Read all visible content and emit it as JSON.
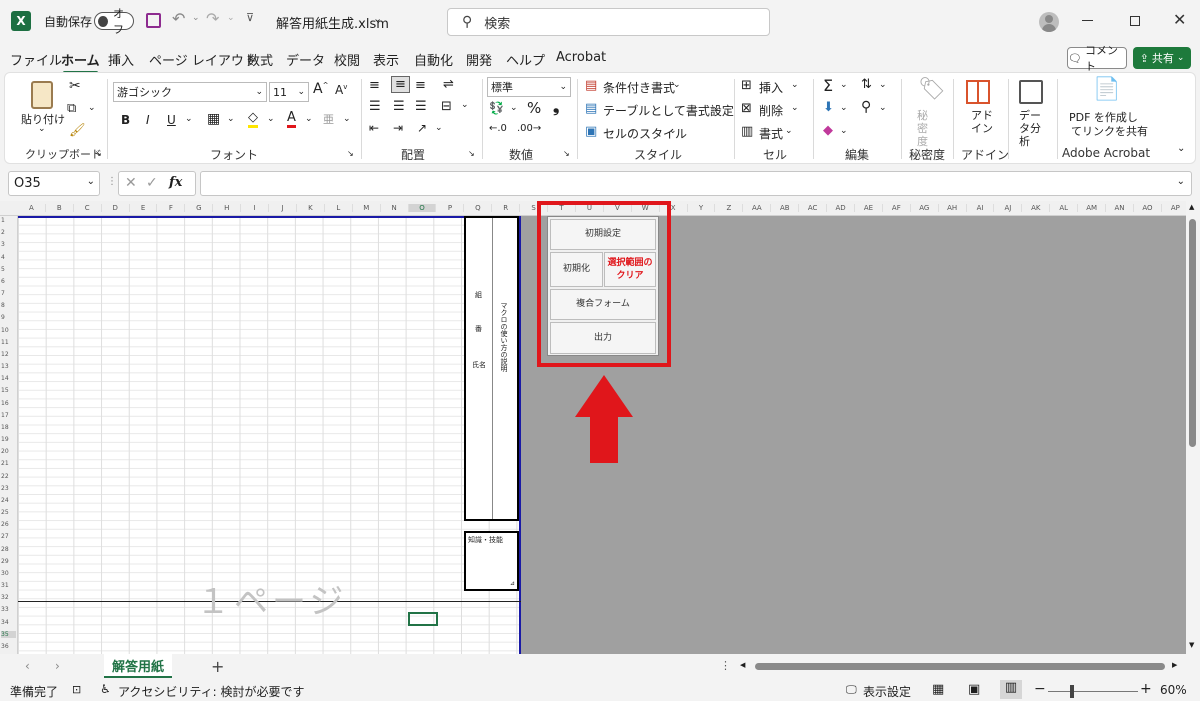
{
  "titlebar": {
    "autosave_label": "自動保存",
    "autosave_state": "オフ",
    "filename": "解答用紙生成.xlsm",
    "search_placeholder": "検索"
  },
  "menu": {
    "items": [
      "ファイル",
      "ホーム",
      "挿入",
      "ページ レイアウト",
      "数式",
      "データ",
      "校閲",
      "表示",
      "自動化",
      "開発",
      "ヘルプ",
      "Acrobat"
    ],
    "active": "ホーム",
    "comment_label": "コメント",
    "share_label": "共有"
  },
  "ribbon": {
    "clipboard": {
      "paste": "貼り付け",
      "label": "クリップボード"
    },
    "font": {
      "name": "游ゴシック",
      "size": "11",
      "label": "フォント"
    },
    "alignment": {
      "label": "配置"
    },
    "number": {
      "format": "標準",
      "label": "数値"
    },
    "styles": {
      "conditional": "条件付き書式",
      "table": "テーブルとして書式設定",
      "cell_style": "セルのスタイル",
      "label": "スタイル"
    },
    "cells": {
      "insert": "挿入",
      "delete": "削除",
      "format": "書式",
      "label": "セル"
    },
    "editing": {
      "label": "編集"
    },
    "sensitivity": {
      "button": "秘密度",
      "label": "秘密度"
    },
    "addins": {
      "button": "アドイン",
      "label": "アドイン"
    },
    "analysis": {
      "button": "データ分析"
    },
    "acrobat": {
      "button_line1": "PDF を作成し",
      "button_line2": "てリンクを共有",
      "label": "Adobe Acrobat"
    }
  },
  "formula": {
    "namebox": "O35",
    "fx": "fx",
    "value": ""
  },
  "sheet": {
    "columns": [
      "A",
      "B",
      "C",
      "D",
      "E",
      "F",
      "G",
      "H",
      "I",
      "J",
      "K",
      "L",
      "M",
      "N",
      "O",
      "P",
      "Q",
      "R",
      "S",
      "T",
      "U",
      "V",
      "W",
      "X",
      "Y",
      "Z",
      "AA",
      "AB",
      "AC",
      "AD",
      "AE",
      "AF",
      "AG",
      "AH",
      "AI",
      "AJ",
      "AK",
      "AL",
      "AM",
      "AN",
      "AO",
      "AP"
    ],
    "rows": [
      "1",
      "2",
      "3",
      "4",
      "5",
      "6",
      "7",
      "8",
      "9",
      "10",
      "11",
      "12",
      "13",
      "14",
      "15",
      "16",
      "17",
      "18",
      "19",
      "20",
      "21",
      "22",
      "23",
      "24",
      "25",
      "26",
      "27",
      "28",
      "29",
      "30",
      "31",
      "32",
      "33",
      "34",
      "35",
      "36"
    ],
    "watermark": "１ページ",
    "labels": {
      "kumi": "組",
      "ban": "番",
      "shimei": "氏名",
      "vertical_note": "マクロの使い方の説明",
      "chishiki": "知識・技能"
    }
  },
  "macro_buttons": {
    "initial_settings": "初期設定",
    "initialize": "初期化",
    "clear_line1": "選択範囲の",
    "clear_line2": "クリア",
    "duplicate_form": "複合フォーム",
    "output": "出力"
  },
  "annotation": {
    "box_color": "#e0161b",
    "arrow_color": "#e0161b"
  },
  "tabs": {
    "sheet_name": "解答用紙",
    "add": "+"
  },
  "status": {
    "ready": "準備完了",
    "accessibility": "アクセシビリティ: 検討が必要です",
    "display_settings": "表示設定",
    "zoom": "60%"
  },
  "colors": {
    "excel_green": "#217346",
    "page_border": "#1a1aa6",
    "share_green": "#1e7a3c"
  }
}
